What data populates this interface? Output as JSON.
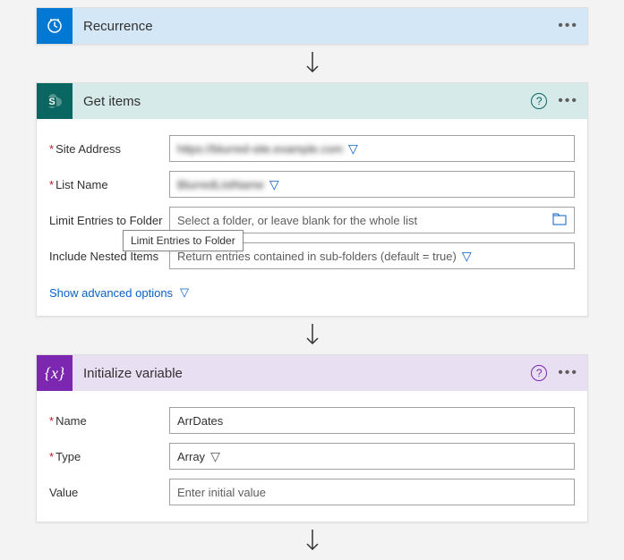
{
  "recurrence": {
    "title": "Recurrence"
  },
  "getitems": {
    "title": "Get items",
    "site_address_label": "Site Address",
    "site_address_value": "https://blurred-site.example.com",
    "list_name_label": "List Name",
    "list_name_value": "BlurredListName",
    "limit_folder_label": "Limit Entries to Folder",
    "limit_folder_placeholder": "Select a folder, or leave blank for the whole list",
    "include_nested_label": "Include Nested Items",
    "include_nested_placeholder": "Return entries contained in sub-folders (default = true)",
    "show_advanced": "Show advanced options",
    "tooltip": "Limit Entries to Folder"
  },
  "initvar": {
    "title": "Initialize variable",
    "name_label": "Name",
    "name_value": "ArrDates",
    "type_label": "Type",
    "type_value": "Array",
    "value_label": "Value",
    "value_placeholder": "Enter initial value"
  }
}
